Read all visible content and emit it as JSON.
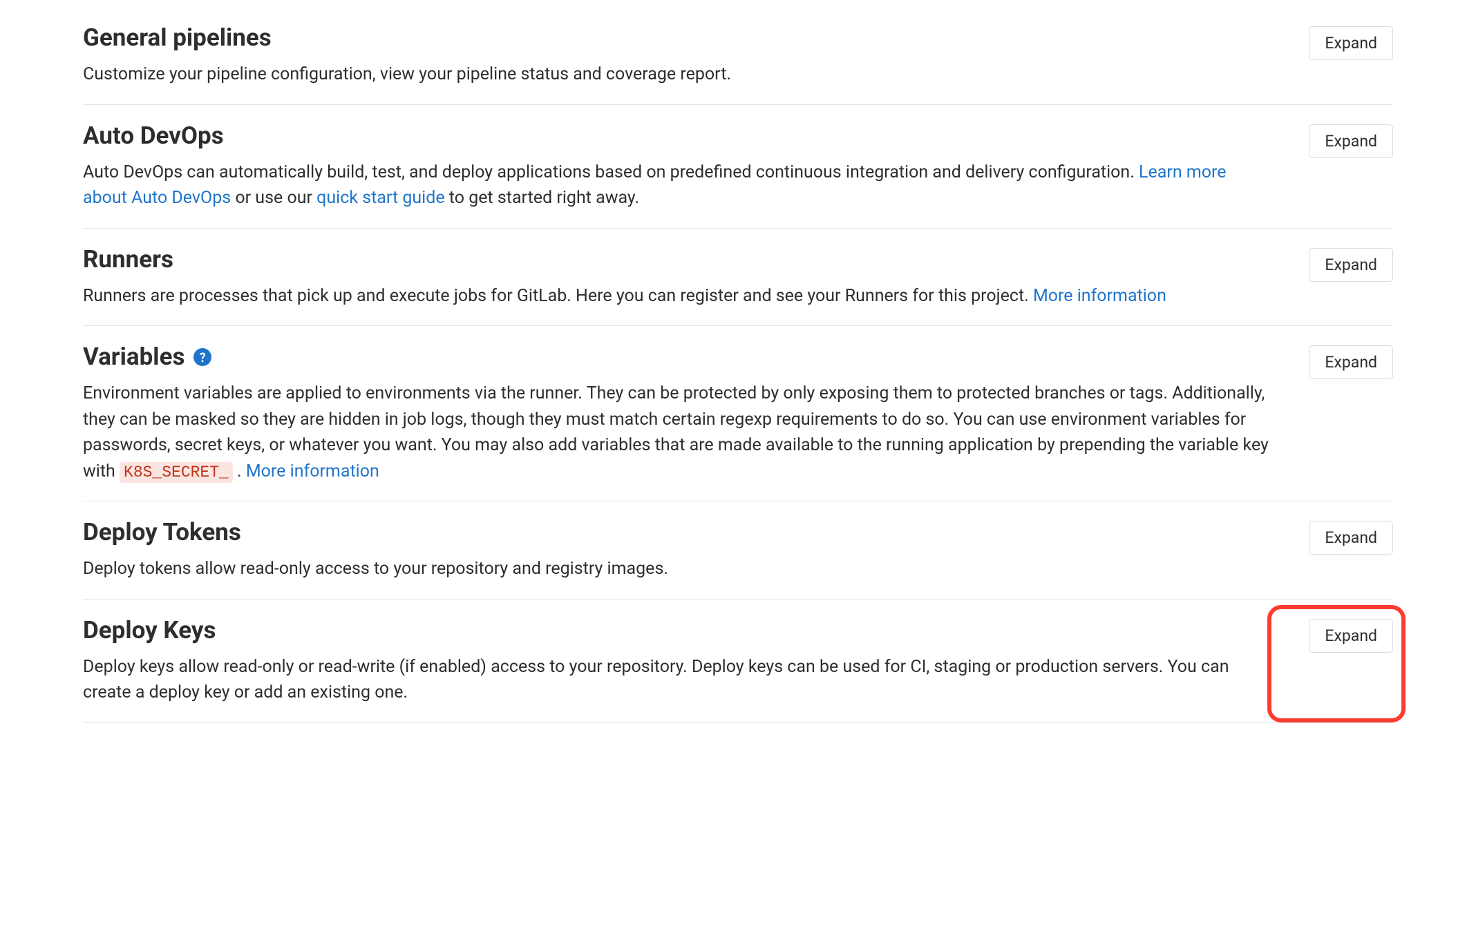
{
  "sections": {
    "general_pipelines": {
      "title": "General pipelines",
      "desc": "Customize your pipeline configuration, view your pipeline status and coverage report.",
      "expand": "Expand"
    },
    "auto_devops": {
      "title": "Auto DevOps",
      "desc_pre": "Auto DevOps can automatically build, test, and deploy applications based on predefined continuous integration and delivery configuration. ",
      "link1": "Learn more about Auto DevOps",
      "desc_mid": " or use our ",
      "link2": "quick start guide",
      "desc_post": " to get started right away.",
      "expand": "Expand"
    },
    "runners": {
      "title": "Runners",
      "desc_pre": "Runners are processes that pick up and execute jobs for GitLab. Here you can register and see your Runners for this project. ",
      "link1": "More information",
      "expand": "Expand"
    },
    "variables": {
      "title": "Variables",
      "desc_pre": "Environment variables are applied to environments via the runner. They can be protected by only exposing them to protected branches or tags. Additionally, they can be masked so they are hidden in job logs, though they must match certain regexp requirements to do so. You can use environment variables for passwords, secret keys, or whatever you want. You may also add variables that are made available to the running application by prepending the variable key with ",
      "code": "K8S_SECRET_",
      "desc_mid": " . ",
      "link1": "More information",
      "expand": "Expand"
    },
    "deploy_tokens": {
      "title": "Deploy Tokens",
      "desc": "Deploy tokens allow read-only access to your repository and registry images.",
      "expand": "Expand"
    },
    "deploy_keys": {
      "title": "Deploy Keys",
      "desc": "Deploy keys allow read-only or read-write (if enabled) access to your repository. Deploy keys can be used for CI, staging or production servers. You can create a deploy key or add an existing one.",
      "expand": "Expand"
    }
  }
}
